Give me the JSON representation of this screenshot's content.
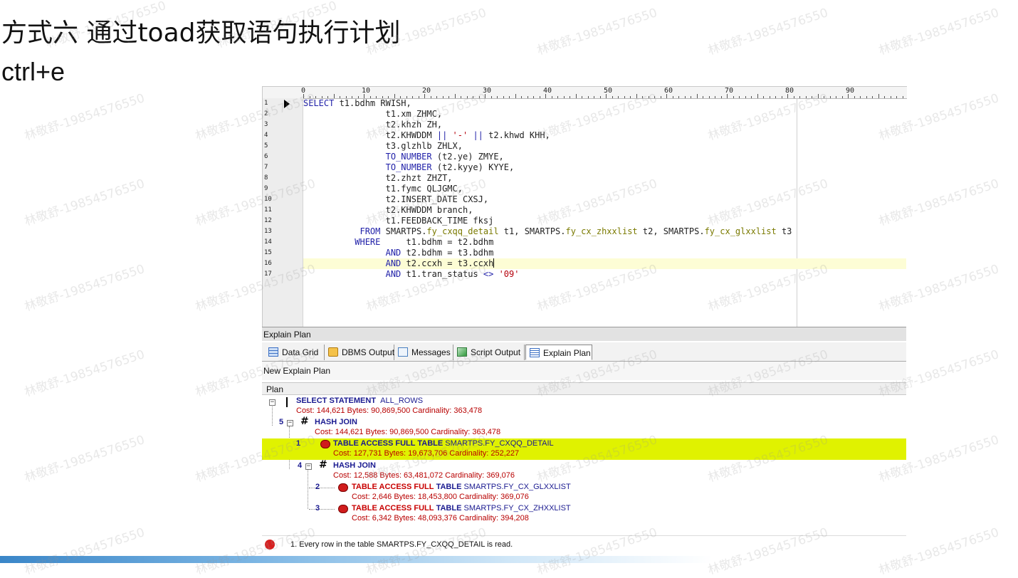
{
  "slide": {
    "title": "方式六 通过toad获取语句执行计划",
    "subtitle": "ctrl+e",
    "watermark": "林敬舒-19854576550"
  },
  "editor": {
    "ruler_numbers": [
      "0",
      "10",
      "20",
      "30",
      "40",
      "50",
      "60",
      "70",
      "80",
      "90"
    ],
    "line_numbers": [
      "1",
      "2",
      "3",
      "4",
      "5",
      "6",
      "7",
      "8",
      "9",
      "10",
      "11",
      "12",
      "13",
      "14",
      "15",
      "16",
      "17"
    ],
    "lines": [
      [
        {
          "t": "SELECT",
          "c": "kw"
        },
        {
          "t": " t1.bdhm RWISH,",
          "c": ""
        }
      ],
      [
        {
          "t": "                t1.xm ZHMC,",
          "c": ""
        }
      ],
      [
        {
          "t": "                t2.khzh ZH,",
          "c": ""
        }
      ],
      [
        {
          "t": "                t2.KHWDDM ",
          "c": ""
        },
        {
          "t": "||",
          "c": "op"
        },
        {
          "t": " ",
          "c": ""
        },
        {
          "t": "'-'",
          "c": "str"
        },
        {
          "t": " ",
          "c": ""
        },
        {
          "t": "||",
          "c": "op"
        },
        {
          "t": " t2.khwd KHH,",
          "c": ""
        }
      ],
      [
        {
          "t": "                t3.glzhlb ZHLX,",
          "c": ""
        }
      ],
      [
        {
          "t": "                ",
          "c": ""
        },
        {
          "t": "TO_NUMBER",
          "c": "fn"
        },
        {
          "t": " (t2.ye) ZMYE,",
          "c": ""
        }
      ],
      [
        {
          "t": "                ",
          "c": ""
        },
        {
          "t": "TO_NUMBER",
          "c": "fn"
        },
        {
          "t": " (t2.kyye) KYYE,",
          "c": ""
        }
      ],
      [
        {
          "t": "                t2.zhzt ZHZT,",
          "c": ""
        }
      ],
      [
        {
          "t": "                t1.fymc QLJGMC,",
          "c": ""
        }
      ],
      [
        {
          "t": "                t2.INSERT_DATE CXSJ,",
          "c": ""
        }
      ],
      [
        {
          "t": "                t2.KHWDDM branch,",
          "c": ""
        }
      ],
      [
        {
          "t": "                t1.FEEDBACK_TIME fksj",
          "c": ""
        }
      ],
      [
        {
          "t": "           ",
          "c": ""
        },
        {
          "t": "FROM",
          "c": "kw"
        },
        {
          "t": " SMARTPS.",
          "c": ""
        },
        {
          "t": "fy_cxqq_detail",
          "c": "tb"
        },
        {
          "t": " t1, SMARTPS.",
          "c": ""
        },
        {
          "t": "fy_cx_zhxxlist",
          "c": "tb"
        },
        {
          "t": " t2, SMARTPS.",
          "c": ""
        },
        {
          "t": "fy_cx_glxxlist",
          "c": "tb"
        },
        {
          "t": " t3",
          "c": ""
        }
      ],
      [
        {
          "t": "          ",
          "c": ""
        },
        {
          "t": "WHERE",
          "c": "kw"
        },
        {
          "t": "     t1.bdhm = t2.bdhm",
          "c": ""
        }
      ],
      [
        {
          "t": "                ",
          "c": ""
        },
        {
          "t": "AND",
          "c": "kw"
        },
        {
          "t": " t2.bdhm = t3.bdhm",
          "c": ""
        }
      ],
      [
        {
          "t": "                ",
          "c": ""
        },
        {
          "t": "AND",
          "c": "kw"
        },
        {
          "t": " t2.ccxh = t3.ccxh",
          "c": ""
        }
      ],
      [
        {
          "t": "                ",
          "c": ""
        },
        {
          "t": "AND",
          "c": "kw"
        },
        {
          "t": " t1.tran_status ",
          "c": ""
        },
        {
          "t": "<>",
          "c": "op"
        },
        {
          "t": " ",
          "c": ""
        },
        {
          "t": "'09'",
          "c": "str"
        }
      ]
    ]
  },
  "panel": {
    "title": "Explain Plan",
    "tabs": [
      {
        "label": "Data Grid",
        "icon": "data-grid-icon",
        "color": "#3b6fc4"
      },
      {
        "label": "DBMS Output",
        "icon": "dbms-output-icon",
        "color": "#e0a020"
      },
      {
        "label": "Messages",
        "icon": "messages-icon",
        "color": "#4a7fc0"
      },
      {
        "label": "Script Output",
        "icon": "script-output-icon",
        "color": "#2f9a3a"
      },
      {
        "label": "Explain Plan",
        "icon": "explain-plan-icon",
        "color": "#3b6fc4"
      }
    ],
    "active_tab": "Explain Plan",
    "toolbar_label": "New Explain Plan",
    "plan_header": "Plan"
  },
  "plan": {
    "nodes": [
      {
        "seq": "",
        "op": "SELECT STATEMENT",
        "op_color": "blue",
        "obj": "ALL_ROWS",
        "cost": "Cost: 144,621  Bytes: 90,869,500  Cardinality: 363,478",
        "selected": false
      },
      {
        "seq": "5",
        "op": "HASH JOIN",
        "op_color": "blue",
        "obj": "",
        "cost": "Cost: 144,621  Bytes: 90,869,500  Cardinality: 363,478",
        "selected": false
      },
      {
        "seq": "1",
        "op": "TABLE ACCESS FULL TABLE",
        "op_color": "blue",
        "obj": "SMARTPS.FY_CXQQ_DETAIL",
        "cost": "Cost: 127,731  Bytes: 19,673,706  Cardinality: 252,227",
        "selected": true
      },
      {
        "seq": "4",
        "op": "HASH JOIN",
        "op_color": "blue",
        "obj": "",
        "cost": "Cost: 12,588  Bytes: 63,481,072  Cardinality: 369,076",
        "selected": false
      },
      {
        "seq": "2",
        "op_red": "TABLE ACCESS FULL",
        "op": "TABLE",
        "obj": "SMARTPS.FY_CX_GLXXLIST",
        "cost": "Cost: 2,646  Bytes: 18,453,800  Cardinality: 369,076",
        "selected": false
      },
      {
        "seq": "3",
        "op_red": "TABLE ACCESS FULL",
        "op": "TABLE",
        "obj": "SMARTPS.FY_CX_ZHXXLIST",
        "cost": "Cost: 6,342  Bytes: 48,093,376  Cardinality: 394,208",
        "selected": false
      }
    ],
    "status_text": "1. Every row in the table SMARTPS.FY_CXQQ_DETAIL  is read.",
    "highlight_color": "#e0f200"
  }
}
